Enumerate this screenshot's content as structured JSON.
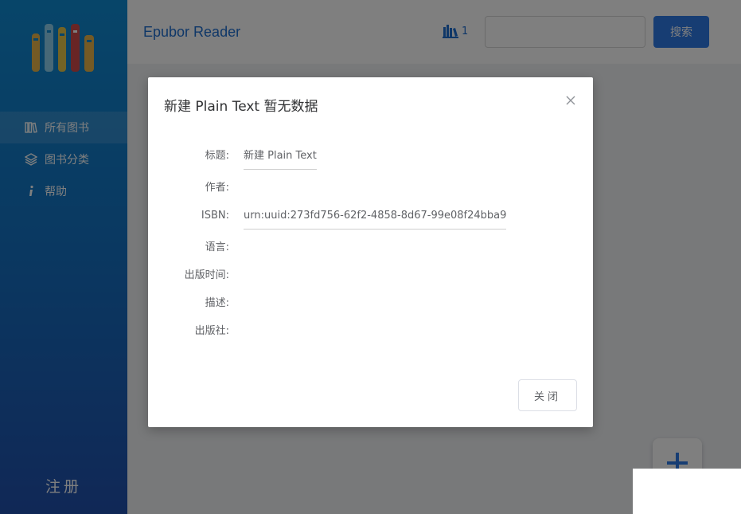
{
  "app": {
    "title": "Epubor Reader",
    "book_count": "1",
    "search_placeholder": "",
    "search_button": "搜索"
  },
  "sidebar": {
    "items": [
      {
        "label": "所有图书",
        "icon": "books-icon",
        "active": true
      },
      {
        "label": "图书分类",
        "icon": "layers-icon",
        "active": false
      },
      {
        "label": "帮助",
        "icon": "info-icon",
        "active": false
      }
    ],
    "register_label": "注册"
  },
  "dialog": {
    "title": "新建 Plain Text 暂无数据",
    "fields": [
      {
        "label": "标题:",
        "value": "新建 Plain Text"
      },
      {
        "label": "作者:",
        "value": ""
      },
      {
        "label": "ISBN:",
        "value": "urn:uuid:273fd756-62f2-4858-8d67-99e08f24bba9"
      },
      {
        "label": "语言:",
        "value": ""
      },
      {
        "label": "出版时间:",
        "value": ""
      },
      {
        "label": "描述:",
        "value": ""
      },
      {
        "label": "出版社:",
        "value": ""
      }
    ],
    "close_button": "关闭"
  },
  "colors": {
    "accent": "#2f7be6",
    "title_blue": "#1f6fd1",
    "sidebar_top": "#0f8bd3",
    "sidebar_bottom": "#2150ad"
  }
}
